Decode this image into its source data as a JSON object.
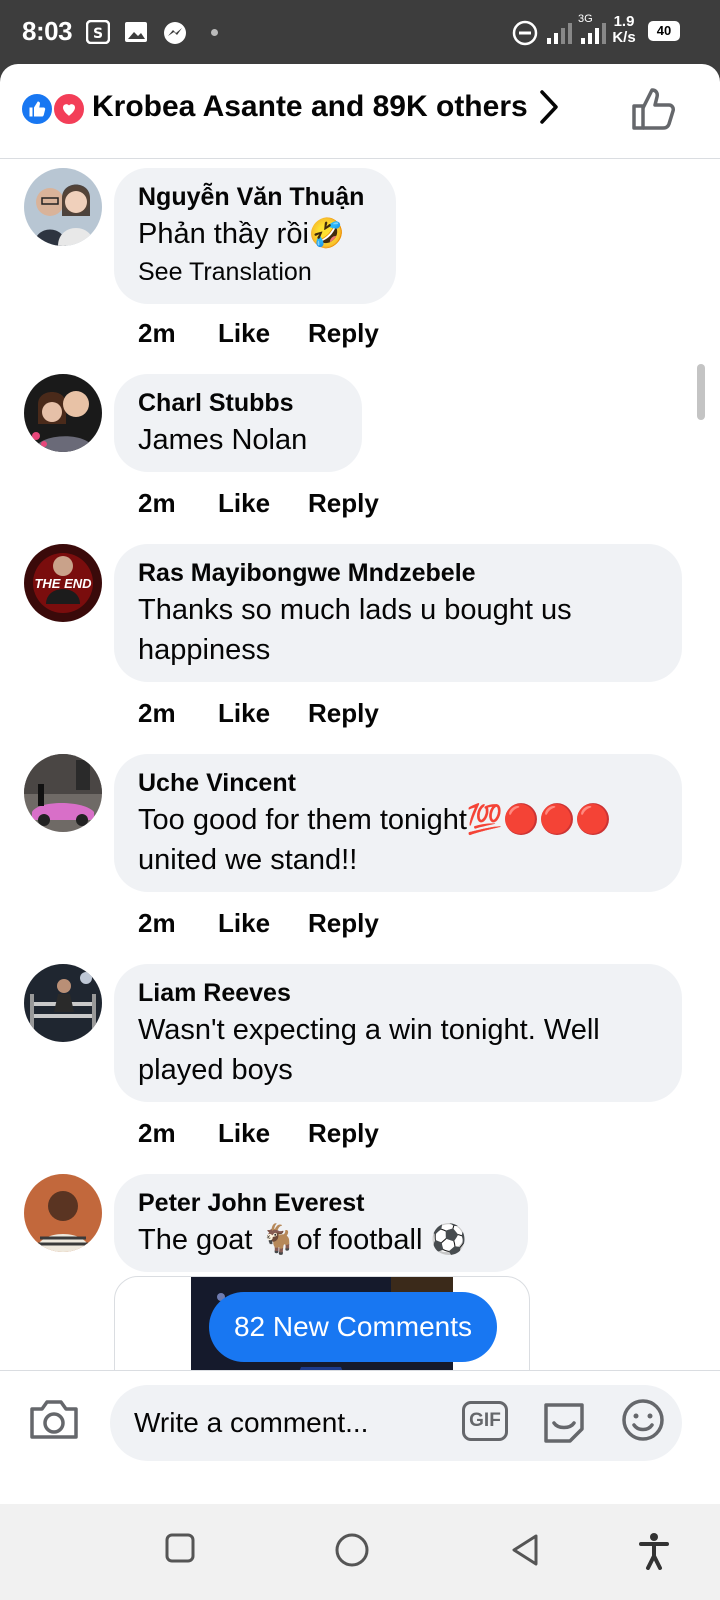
{
  "status_bar": {
    "time": "8:03",
    "network": "3G",
    "speed_value": "1.9",
    "speed_unit": "K/s",
    "battery": "40"
  },
  "header": {
    "reactions_text": "Krobea Asante and 89K others",
    "reaction_icons": [
      "like-icon",
      "love-icon"
    ]
  },
  "comments": [
    {
      "author": "Nguyễn Văn Thuận",
      "text": "Phản thầy rồi🤣",
      "translation": "See Translation",
      "time": "2m",
      "like": "Like",
      "reply": "Reply"
    },
    {
      "author": "Charl Stubbs",
      "text": "James Nolan",
      "time": "2m",
      "like": "Like",
      "reply": "Reply"
    },
    {
      "author": "Ras Mayibongwe Mndzebele",
      "text": "Thanks so much lads u bought us happiness",
      "time": "2m",
      "like": "Like",
      "reply": "Reply",
      "avatar_text": "THE END"
    },
    {
      "author": "Uche Vincent",
      "text": "Too good for them tonight💯🔴🔴🔴 united we stand!!",
      "time": "2m",
      "like": "Like",
      "reply": "Reply"
    },
    {
      "author": "Liam Reeves",
      "text": "Wasn't expecting a win tonight. Well played boys",
      "time": "2m",
      "like": "Like",
      "reply": "Reply"
    },
    {
      "author": "Peter John Everest",
      "text": "The goat 🐐of football ⚽",
      "time": "",
      "like": "",
      "reply": ""
    }
  ],
  "new_comments_pill": "82 New Comments",
  "composer": {
    "placeholder": "Write a comment...",
    "gif_label": "GIF"
  },
  "colors": {
    "accent": "#1877f2",
    "love": "#f33e58",
    "bubble": "#f0f2f5",
    "status_bar": "#3d3d3d"
  }
}
